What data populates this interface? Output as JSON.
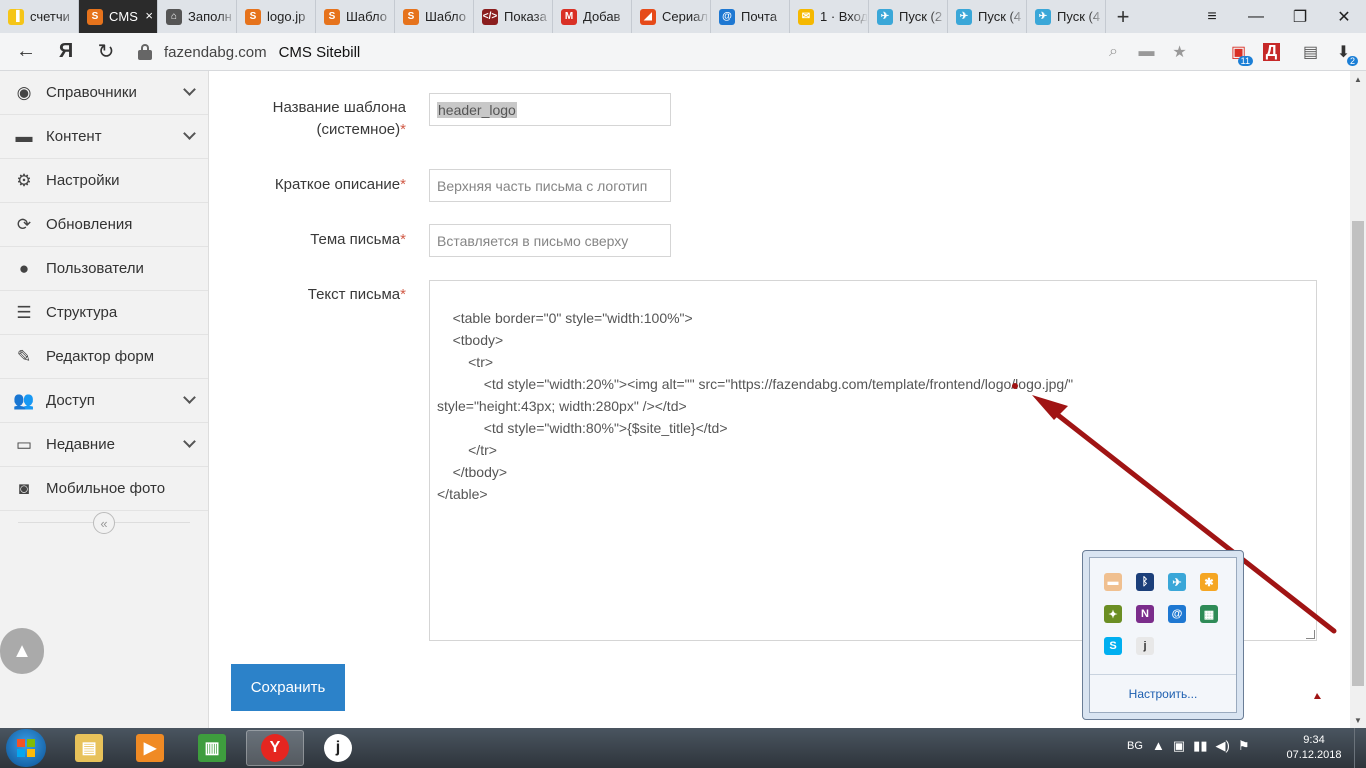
{
  "browser": {
    "tabs": [
      {
        "label": "счетчи",
        "favicon_color": "#f5c518",
        "favicon_glyph": "▐"
      },
      {
        "label": "CMS",
        "favicon_color": "#e6731c",
        "favicon_glyph": "S",
        "active": true
      },
      {
        "label": "Заполн",
        "favicon_color": "#555555",
        "favicon_glyph": "⌂"
      },
      {
        "label": "logo.jp",
        "favicon_color": "#e6731c",
        "favicon_glyph": "S"
      },
      {
        "label": "Шабло",
        "favicon_color": "#e6731c",
        "favicon_glyph": "S"
      },
      {
        "label": "Шабло",
        "favicon_color": "#e6731c",
        "favicon_glyph": "S"
      },
      {
        "label": "Показа",
        "favicon_color": "#8b1e1e",
        "favicon_glyph": "</>"
      },
      {
        "label": "Добав",
        "favicon_color": "#d93025",
        "favicon_glyph": "M"
      },
      {
        "label": "Сериал",
        "favicon_color": "#e64a19",
        "favicon_glyph": "◢"
      },
      {
        "label": "Почта",
        "favicon_color": "#1e78d2",
        "favicon_glyph": "@"
      },
      {
        "label": "1 · Вход",
        "favicon_color": "#f5b800",
        "favicon_glyph": "✉"
      },
      {
        "label": "Пуск (2",
        "favicon_color": "#3aa7d8",
        "favicon_glyph": "✈"
      },
      {
        "label": "Пуск (4",
        "favicon_color": "#3aa7d8",
        "favicon_glyph": "✈"
      },
      {
        "label": "Пуск (4",
        "favicon_color": "#3aa7d8",
        "favicon_glyph": "✈"
      }
    ],
    "new_tab_glyph": "+",
    "active_tab_close": "×",
    "window_buttons": {
      "menu": "≡",
      "minimize": "—",
      "restore": "❐",
      "close": "✕"
    },
    "address": {
      "back": "←",
      "yandex": "Я",
      "reload": "↻",
      "domain": "fazendabg.com",
      "page_title": "CMS Sitebill",
      "download_badge": "2",
      "mail_badge": "11"
    }
  },
  "sidebar": {
    "items": [
      {
        "label": "Справочники",
        "icon": "globe-icon",
        "glyph": "◉",
        "has_submenu": true
      },
      {
        "label": "Контент",
        "icon": "laptop-icon",
        "glyph": "▬",
        "has_submenu": true
      },
      {
        "label": "Настройки",
        "icon": "gear-icon",
        "glyph": "⚙",
        "has_submenu": false
      },
      {
        "label": "Обновления",
        "icon": "refresh-icon",
        "glyph": "⟳",
        "has_submenu": false
      },
      {
        "label": "Пользователи",
        "icon": "user-icon",
        "glyph": "●",
        "has_submenu": false
      },
      {
        "label": "Структура",
        "icon": "list-icon",
        "glyph": "☰",
        "has_submenu": false
      },
      {
        "label": "Редактор форм",
        "icon": "edit-icon",
        "glyph": "✎",
        "has_submenu": false
      },
      {
        "label": "Доступ",
        "icon": "users-icon",
        "glyph": "👥",
        "has_submenu": true
      },
      {
        "label": "Недавние",
        "icon": "desktop-icon",
        "glyph": "▭",
        "has_submenu": true
      },
      {
        "label": "Мобильное фото",
        "icon": "camera-icon",
        "glyph": "◙",
        "has_submenu": false
      }
    ],
    "collapse_glyph": "«",
    "scroll_top_glyph": "▲"
  },
  "form": {
    "fields": [
      {
        "label_line1": "Название шаблона",
        "label_line2": "(системное)",
        "required": "*",
        "value": "header_logo"
      },
      {
        "label": "Краткое описание",
        "required": "*",
        "value": "Верхняя часть письма с логотип"
      },
      {
        "label": "Тема письма",
        "required": "*",
        "value": "Вставляется в письмо сверху"
      },
      {
        "label": "Текст письма",
        "required": "*"
      }
    ],
    "textarea_value": "<table border=\"0\" style=\"width:100%\">\n\t<tbody>\n\t\t<tr>\n\t\t\t<td style=\"width:20%\"><img alt=\"\" src=\"https://fazendabg.com/template/frontend/logo/logo.jpg/\"\nstyle=\"height:43px; width:280px\" /></td>\n\t\t\t<td style=\"width:80%\">{$site_title}</td>\n\t\t</tr>\n\t</tbody>\n</table>",
    "save_label": "Сохранить"
  },
  "tray_popup": {
    "icons": [
      {
        "name": "eraser-icon",
        "color": "#f0c090",
        "glyph": "▬"
      },
      {
        "name": "bluetooth-icon",
        "color": "#1c3f7a",
        "glyph": "ᛒ"
      },
      {
        "name": "telegram-icon",
        "color": "#3aa7d8",
        "glyph": "✈"
      },
      {
        "name": "star-app-icon",
        "color": "#f5a623",
        "glyph": "✱"
      },
      {
        "name": "bird-icon",
        "color": "#6b8e23",
        "glyph": "✦"
      },
      {
        "name": "onenote-icon",
        "color": "#7b2d8b",
        "glyph": "N"
      },
      {
        "name": "at-mail-icon",
        "color": "#1e78d2",
        "glyph": "@"
      },
      {
        "name": "windows-app-icon",
        "color": "#2e8b57",
        "glyph": "▦"
      },
      {
        "name": "skype-icon",
        "color": "#00aff0",
        "glyph": "S"
      },
      {
        "name": "j-app-icon",
        "color": "#e8e8e8",
        "glyph": "j"
      }
    ],
    "customize_label": "Настроить..."
  },
  "taskbar": {
    "language": "BG",
    "time": "9:34",
    "date": "07.12.2018",
    "tray_glyphs": [
      "▲",
      "▣",
      "▮▮",
      "◀)",
      "⚑"
    ],
    "apps": [
      {
        "name": "explorer-icon",
        "color": "#e8c25a",
        "glyph": "▤"
      },
      {
        "name": "media-player-icon",
        "color": "#f08a24",
        "glyph": "▶"
      },
      {
        "name": "chart-app-icon",
        "color": "#3e9d3e",
        "glyph": "▥"
      },
      {
        "name": "yandex-browser-icon",
        "color": "#e52620",
        "glyph": "Y",
        "active": true
      },
      {
        "name": "j-app-taskbar-icon",
        "color": "#ffffff",
        "glyph": "j"
      }
    ]
  }
}
